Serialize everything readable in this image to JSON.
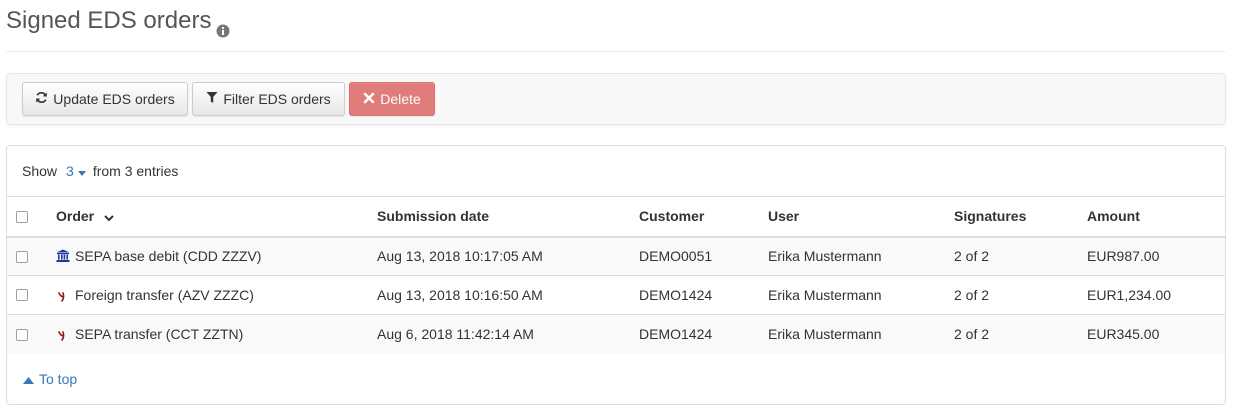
{
  "page": {
    "title": "Signed EDS orders"
  },
  "toolbar": {
    "update_label": "Update EDS orders",
    "filter_label": "Filter EDS orders",
    "delete_label": "Delete"
  },
  "listing": {
    "show_label": "Show",
    "show_count": "3",
    "show_suffix": "from 3 entries"
  },
  "table": {
    "columns": {
      "order": "Order",
      "submission_date": "Submission date",
      "customer": "Customer",
      "user": "User",
      "signatures": "Signatures",
      "amount": "Amount"
    },
    "rows": [
      {
        "icon": "bank-icon",
        "order": "SEPA base debit (CDD ZZZV)",
        "submission_date": "Aug 13, 2018 10:17:05 AM",
        "customer": "DEMO0051",
        "user": "Erika Mustermann",
        "signatures": "2 of 2",
        "amount": "EUR987.00"
      },
      {
        "icon": "transfer-icon",
        "order": "Foreign transfer (AZV ZZZC)",
        "submission_date": "Aug 13, 2018 10:16:50 AM",
        "customer": "DEMO1424",
        "user": "Erika Mustermann",
        "signatures": "2 of 2",
        "amount": "EUR1,234.00"
      },
      {
        "icon": "transfer-icon",
        "order": "SEPA transfer (CCT ZZTN)",
        "submission_date": "Aug 6, 2018 11:42:14 AM",
        "customer": "DEMO1424",
        "user": "Erika Mustermann",
        "signatures": "2 of 2",
        "amount": "EUR345.00"
      }
    ]
  },
  "footer": {
    "to_top_label": "To top"
  },
  "colors": {
    "link": "#337ab7",
    "danger": "#d9534f",
    "bank_icon": "#1a3a9c",
    "transfer_icon": "#8b1a1a"
  }
}
